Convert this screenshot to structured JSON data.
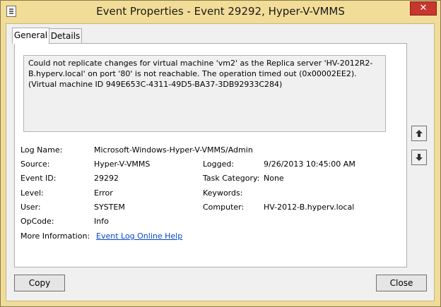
{
  "window": {
    "title": "Event Properties - Event 29292, Hyper-V-VMMS",
    "close_glyph": "✕"
  },
  "tabs": [
    {
      "label": "General"
    },
    {
      "label": "Details"
    }
  ],
  "description": "Could not replicate changes for virtual machine 'vm2' as the Replica server 'HV-2012R2-B.hyperv.local' on port '80' is not reachable. The operation timed out (0x00002EE2). (Virtual machine ID 949E653C-4311-49D5-BA37-3DB92933C284)",
  "fields": {
    "log_name": {
      "label": "Log Name:",
      "value": "Microsoft-Windows-Hyper-V-VMMS/Admin"
    },
    "source": {
      "label": "Source:",
      "value": "Hyper-V-VMMS"
    },
    "logged": {
      "label": "Logged:",
      "value": "9/26/2013 10:45:00 AM"
    },
    "event_id": {
      "label": "Event ID:",
      "value": "29292"
    },
    "task_category": {
      "label": "Task Category:",
      "value": "None"
    },
    "level": {
      "label": "Level:",
      "value": "Error"
    },
    "keywords": {
      "label": "Keywords:",
      "value": ""
    },
    "user": {
      "label": "User:",
      "value": "SYSTEM"
    },
    "computer": {
      "label": "Computer:",
      "value": "HV-2012-B.hyperv.local"
    },
    "opcode": {
      "label": "OpCode:",
      "value": "Info"
    },
    "more_info": {
      "label": "More Information:",
      "value": "Event Log Online Help"
    }
  },
  "buttons": {
    "copy": "Copy",
    "close": "Close"
  },
  "icons": {
    "app": "event-properties-icon",
    "up": "arrow-up-icon",
    "down": "arrow-down-icon"
  },
  "colors": {
    "title_bar": "#f2dd98",
    "close_button": "#c7372f",
    "link": "#0645c8"
  }
}
